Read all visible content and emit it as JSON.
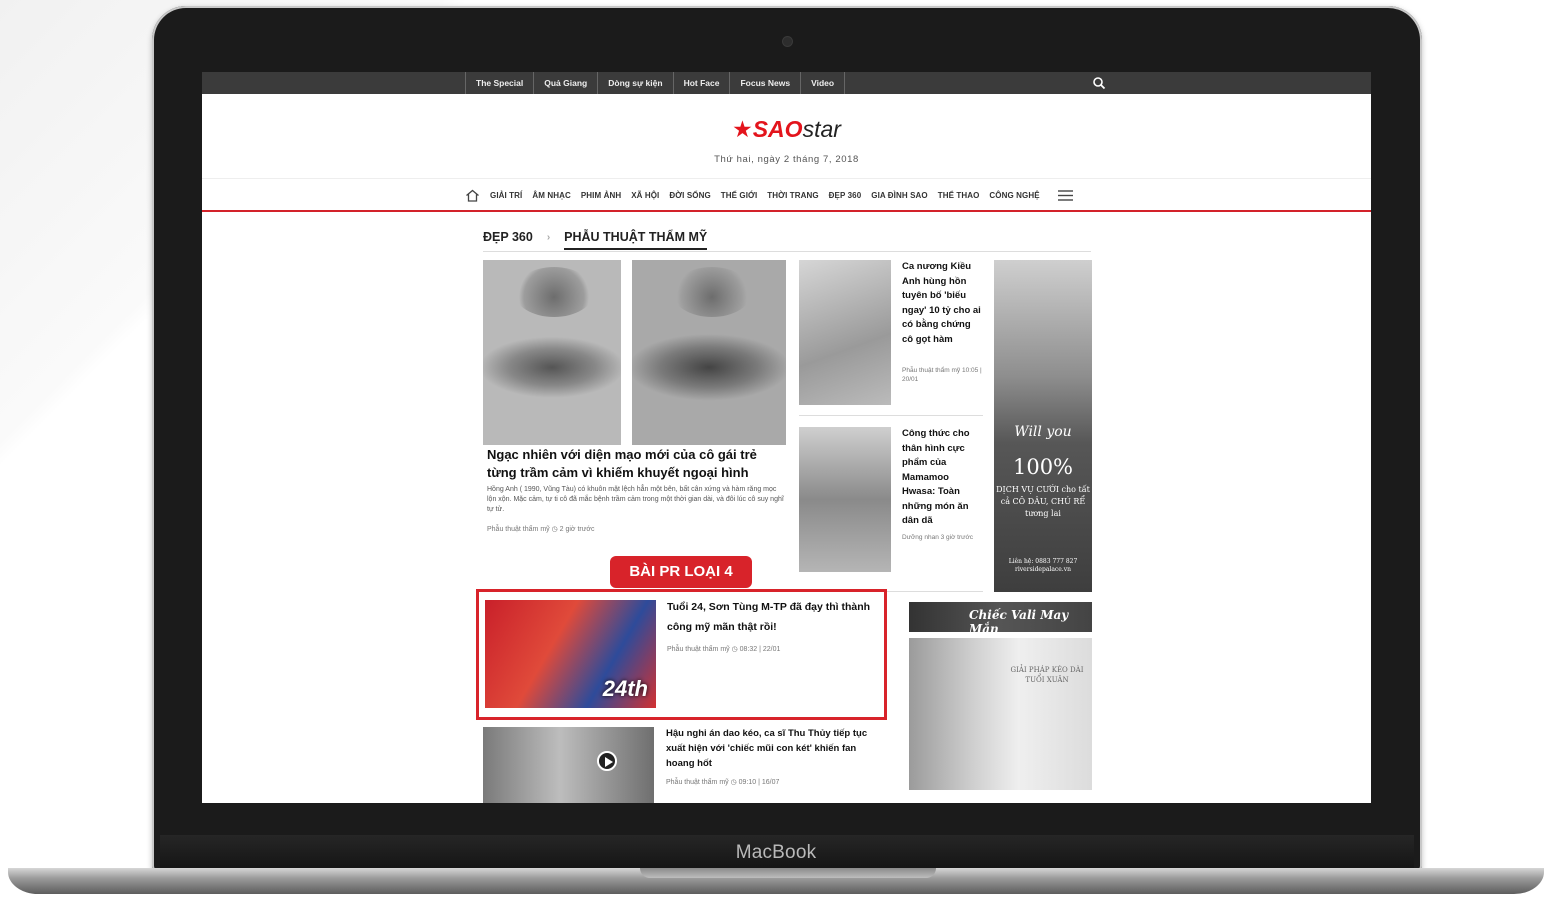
{
  "device": {
    "brand": "MacBook"
  },
  "topnav": {
    "items": [
      "The Special",
      "Quả Giang",
      "Dòng sự kiện",
      "Hot Face",
      "Focus News",
      "Video"
    ]
  },
  "header": {
    "logo_sao": "SAO",
    "logo_star": "star",
    "date": "Thứ hai, ngày 2 tháng 7, 2018"
  },
  "categories": [
    "GIẢI TRÍ",
    "ÂM NHẠC",
    "PHIM ẢNH",
    "XÃ HỘI",
    "ĐỜI SỐNG",
    "THẾ GIỚI",
    "THỜI TRANG",
    "ĐẸP 360",
    "GIA ĐÌNH SAO",
    "THỂ THAO",
    "CÔNG NGHỆ"
  ],
  "breadcrumb": {
    "section": "ĐẸP 360",
    "separator": "›",
    "subsection": "PHẪU THUẬT THẨM MỸ"
  },
  "main_article": {
    "title": "Ngạc nhiên với diện mạo mới của cô gái trẻ từng trầm cảm vì khiếm khuyết ngoại hình",
    "description": "Hồng Anh ( 1990, Vũng Tàu) có khuôn mặt lệch hẳn một bên, bất cân xứng và hàm răng mọc lộn xộn. Mặc cảm, tự ti cô đã mắc bệnh trầm cảm trong một thời gian dài, và đôi lúc cô suy nghĩ tự tử.",
    "meta": "Phẫu thuật thẩm mỹ  ◷ 2 giờ trước"
  },
  "side_articles": [
    {
      "title": "Ca nương Kiều Anh hùng hồn tuyên bố 'biếu ngay' 10 tỷ cho ai có bằng chứng cô gọt hàm",
      "meta": "Phẫu thuật thẩm mỹ 10:05 | 20/01"
    },
    {
      "title": "Công thức cho thân hình cực phẩm của Mamamoo Hwasa: Toàn những món ăn dân dã",
      "meta": "Dưỡng nhan 3 giờ trước"
    }
  ],
  "ad_right": {
    "line1": "Will you",
    "line2": "100%",
    "line3": "DỊCH VỤ CƯỚI cho tất cả CÔ DÂU, CHÚ RỂ tương lai",
    "line4": "Liên hệ: 0883 777 827 riversidepalace.vn"
  },
  "pr": {
    "badge": "BÀI PR LOẠI 4",
    "image_text": "24th",
    "title": "Tuổi 24, Sơn Tùng M-TP đã đạy thì thành công mỹ mãn thật rồi!",
    "meta": "Phẫu thuật thẩm mỹ  ◷ 08:32 | 22/01"
  },
  "ad_bottom": {
    "banner": "Chiếc Vali May Mắn",
    "text": "GIẢI PHÁP KÉO DÀI TUỔI XUÂN"
  },
  "row3": {
    "title": "Hậu nghi án dao kéo, ca sĩ Thu Thủy tiếp tục xuất hiện với 'chiếc mũi con két' khiến fan hoang hốt",
    "meta": "Phẫu thuật thẩm mỹ  ◷ 09:10 | 16/07"
  },
  "colors": {
    "accent": "#d8232a",
    "topbar": "#3b3b3b"
  }
}
